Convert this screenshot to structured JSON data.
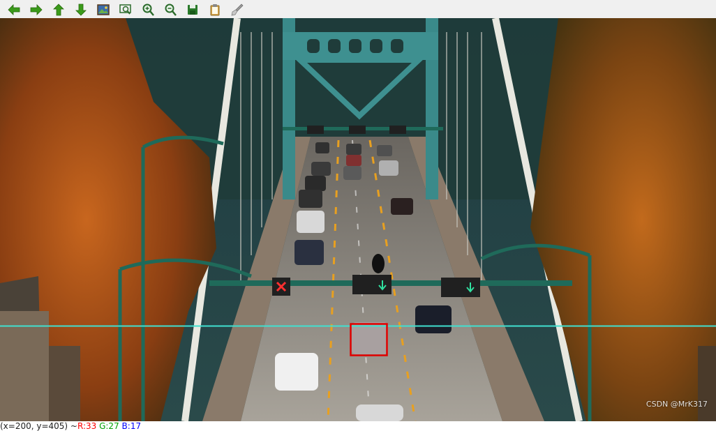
{
  "toolbar": {
    "buttons": [
      {
        "name": "pan-left-button",
        "icon": "arrow-left-icon",
        "color": "#3a9a1a"
      },
      {
        "name": "pan-right-button",
        "icon": "arrow-right-icon",
        "color": "#3a9a1a"
      },
      {
        "name": "pan-up-button",
        "icon": "arrow-up-icon",
        "color": "#3a9a1a"
      },
      {
        "name": "pan-down-button",
        "icon": "arrow-down-icon",
        "color": "#3a9a1a"
      },
      {
        "name": "zoom-fit-button",
        "icon": "image-icon",
        "color": "#2a5a9a"
      },
      {
        "name": "zoom-original-button",
        "icon": "zoom-rect-icon",
        "color": "#2a6a2a"
      },
      {
        "name": "zoom-in-button",
        "icon": "zoom-in-icon",
        "color": "#2a6a2a"
      },
      {
        "name": "zoom-out-button",
        "icon": "zoom-out-icon",
        "color": "#2a6a2a"
      },
      {
        "name": "save-button",
        "icon": "save-icon",
        "color": "#2a7a2a"
      },
      {
        "name": "copy-button",
        "icon": "clipboard-icon",
        "color": "#b8860b"
      },
      {
        "name": "properties-button",
        "icon": "brush-icon",
        "color": "#888888"
      }
    ]
  },
  "overlay": {
    "line_color": "#40e0d0",
    "box_color": "#e00000"
  },
  "status": {
    "coords": "(x=200, y=405) ~ ",
    "r": "R:33",
    "g": "G:27",
    "b": "B:17"
  },
  "watermark": "CSDN @MrK317"
}
